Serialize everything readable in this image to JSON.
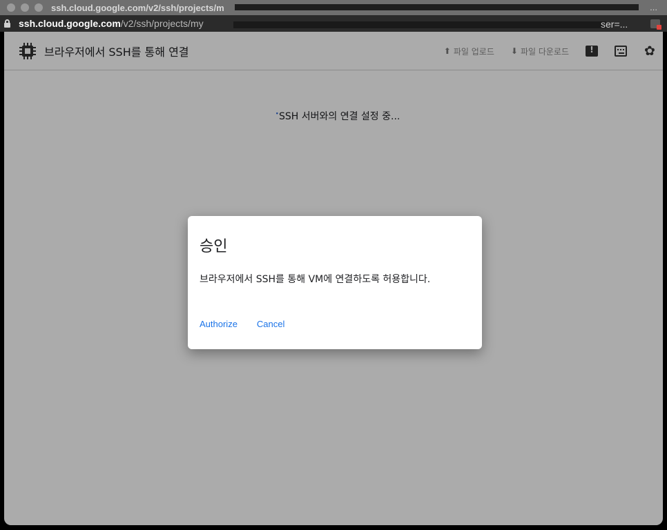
{
  "window": {
    "title": "ssh.cloud.google.com/v2/ssh/projects/m",
    "title_ellipsis": "..."
  },
  "addressbar": {
    "host": "ssh.cloud.google.com",
    "path": "/v2/ssh/projects/my",
    "url_tail": "ser=..."
  },
  "toolbar": {
    "title": "브라우저에서 SSH를 통해 연결",
    "upload_label": "파일 업로드",
    "download_label": "파일 다운로드"
  },
  "status_text": "SSH 서버와의 연결 설정 중...",
  "dialog": {
    "title": "승인",
    "body": "브라우저에서 SSH를 통해 VM에 연결하도록 허용합니다.",
    "authorize_label": "Authorize",
    "cancel_label": "Cancel"
  },
  "colors": {
    "link": "#1a73e8",
    "overlay": "rgba(0,0,0,0.33)"
  },
  "icons": [
    "lock-icon",
    "chip-icon",
    "upload-icon",
    "download-icon",
    "feedback-icon",
    "keyboard-icon",
    "gear-icon",
    "extension-icon"
  ]
}
